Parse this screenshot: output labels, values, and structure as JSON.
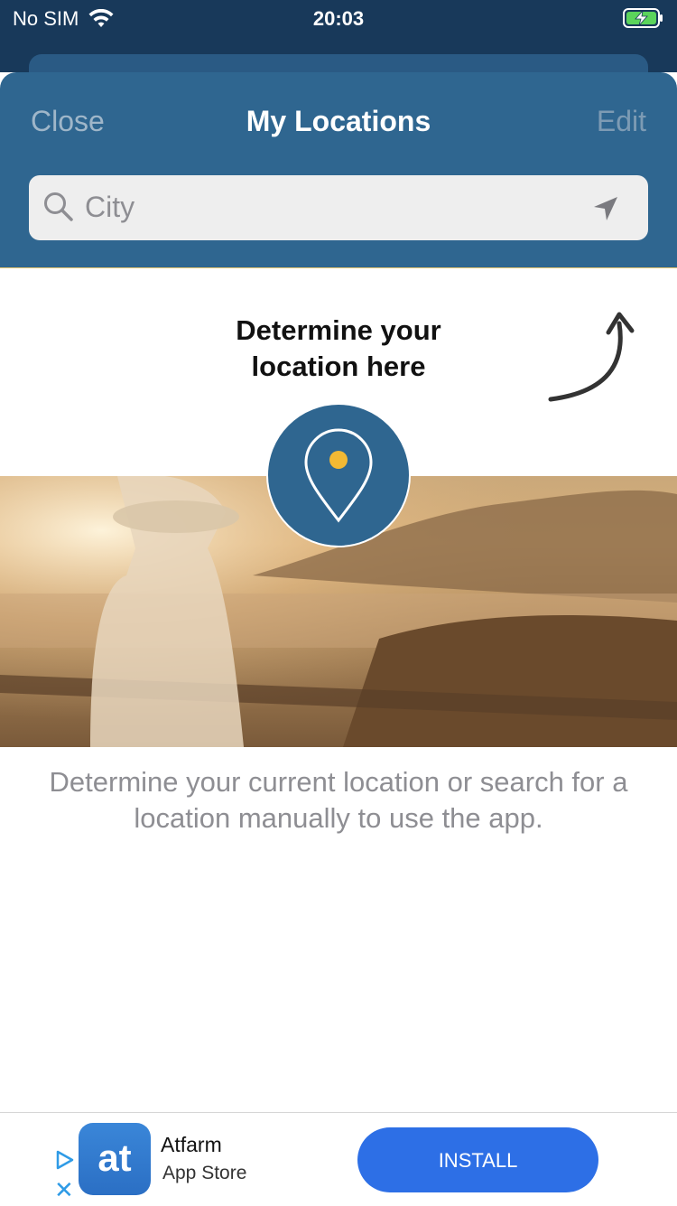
{
  "status_bar": {
    "carrier": "No SIM",
    "time": "20:03"
  },
  "header": {
    "close_label": "Close",
    "title": "My Locations",
    "edit_label": "Edit"
  },
  "search": {
    "placeholder": "City"
  },
  "hint": {
    "line1": "Determine your",
    "line2": "location here"
  },
  "description": "Determine your current location or search for a location manually to use the app.",
  "ad": {
    "app_icon_text": "at",
    "app_name": "Atfarm",
    "store": "App Store",
    "install_label": "INSTALL"
  },
  "colors": {
    "status_bar_bg": "#18395a",
    "header_bg": "#2f6690",
    "pin_dot": "#f2b934",
    "install_button": "#2d6fe6"
  }
}
